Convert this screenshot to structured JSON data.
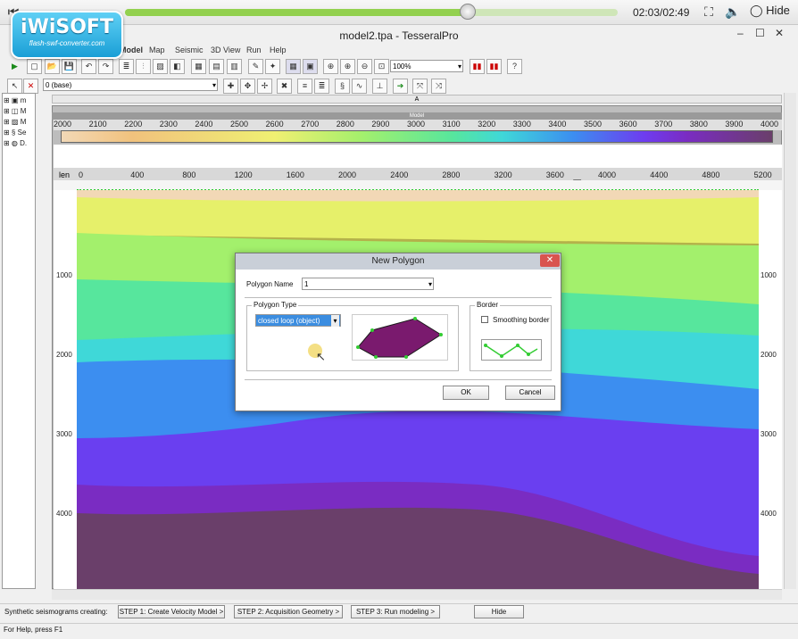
{
  "player": {
    "time": "02:03/02:49",
    "hide_label": "Hide",
    "progress": 0.695
  },
  "logo": {
    "brand": "iWiSOFT",
    "url": "flash-swf-converter.com"
  },
  "window": {
    "title": "model2.tpa - TesseralPro"
  },
  "menu": [
    "Model",
    "Map",
    "Seismic",
    "3D View",
    "Run",
    "Help"
  ],
  "toolbar": {
    "zoom_value": "100%",
    "layer_select": "0 (base)"
  },
  "tree": {
    "items": [
      "m",
      "M",
      "M",
      "Se",
      "D."
    ]
  },
  "model": {
    "header": "Model",
    "ruler_letter": "A",
    "top_axis": [
      "2000",
      "2100",
      "2200",
      "2300",
      "2400",
      "2500",
      "2600",
      "2700",
      "2800",
      "2900",
      "3000",
      "3100",
      "3200",
      "3300",
      "3400",
      "3500",
      "3600",
      "3700",
      "3800",
      "3900",
      "4000"
    ],
    "len_label": "len",
    "len_axis": [
      "0",
      "400",
      "800",
      "1200",
      "1600",
      "2000",
      "2400",
      "2800",
      "3200",
      "3600",
      "4000",
      "4400",
      "4800",
      "5200"
    ],
    "depth_left": [
      "1000",
      "2000",
      "3000",
      "4000"
    ],
    "depth_right": [
      "1000",
      "2000",
      "3000",
      "4000"
    ]
  },
  "dialog": {
    "title": "New Polygon",
    "name_label": "Polygon Name",
    "name_value": "1",
    "type_group": "Polygon Type",
    "type_value": "closed loop (object)",
    "border_group": "Border",
    "smoothing_label": "Smoothing border",
    "ok": "OK",
    "cancel": "Cancel",
    "close": "✕"
  },
  "steps": {
    "label": "Synthetic seismograms creating:",
    "step1": "STEP 1: Create Velocity Model >",
    "step2": "STEP 2: Acquisition Geometry >",
    "step3": "STEP 3: Run modeling >",
    "hide": "Hide"
  },
  "status": {
    "text": "For Help, press F1"
  },
  "colors": {
    "accent": "#93d14f",
    "polygon": "#7a1a6e",
    "vertex": "#33cc33"
  }
}
